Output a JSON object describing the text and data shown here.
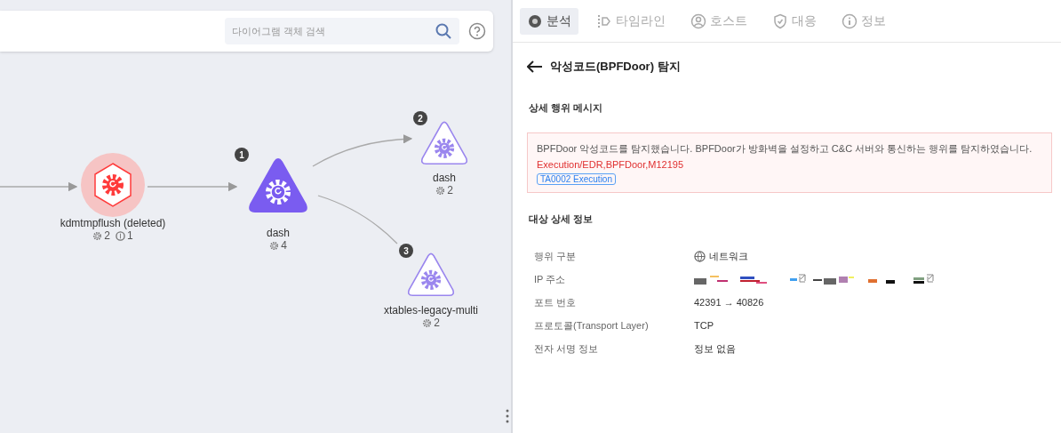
{
  "diagram": {
    "search": {
      "placeholder": "다이어그램 객체 검색"
    },
    "nodes": [
      {
        "kind": "deleted",
        "label": "kdmtmpflush (deleted)",
        "stats": [
          {
            "kind": "gear",
            "count": "2"
          },
          {
            "kind": "disk",
            "count": "1"
          }
        ]
      },
      {
        "kind": "current",
        "badge": "1",
        "label": "dash",
        "stats": [
          {
            "kind": "gear",
            "count": "4"
          }
        ]
      },
      {
        "kind": "child",
        "badge": "2",
        "label": "dash",
        "stats": [
          {
            "kind": "gear",
            "count": "2"
          }
        ]
      },
      {
        "kind": "child",
        "badge": "3",
        "label": "xtables-legacy-multi",
        "stats": [
          {
            "kind": "gear",
            "count": "2"
          }
        ]
      }
    ]
  },
  "tabs": [
    {
      "label": "분석",
      "kind": "analysis",
      "selected": true
    },
    {
      "label": "타임라인",
      "kind": "timeline",
      "selected": false
    },
    {
      "label": "호스트",
      "kind": "host",
      "selected": false
    },
    {
      "label": "대응",
      "kind": "response",
      "selected": false
    },
    {
      "label": "정보",
      "kind": "info",
      "selected": false
    }
  ],
  "title": "악성코드(BPFDoor) 탐지",
  "message_section": {
    "heading": "상세 행위 메시지",
    "text": "BPFDoor 악성코드를 탐지했습니다. BPFDoor가 방화벽을 설정하고 C&C 서버와 통신하는 행위를 탐지하였습니다.",
    "rule": "Execution/EDR,BPFDoor,M12195",
    "tag": "TA0002 Execution"
  },
  "detail_section": {
    "heading": "대상 상세 정보",
    "rows": [
      {
        "label": "행위 구분",
        "kind": "network",
        "value": "네트워크"
      },
      {
        "label": "IP 주소",
        "kind": "redacted"
      },
      {
        "label": "포트 번호",
        "kind": "text",
        "value": "42391 → 40826"
      },
      {
        "label": "프로토콜(Transport Layer)",
        "kind": "text",
        "value": "TCP"
      },
      {
        "label": "전자 서명 정보",
        "kind": "text",
        "value": "정보 없음"
      }
    ]
  }
}
